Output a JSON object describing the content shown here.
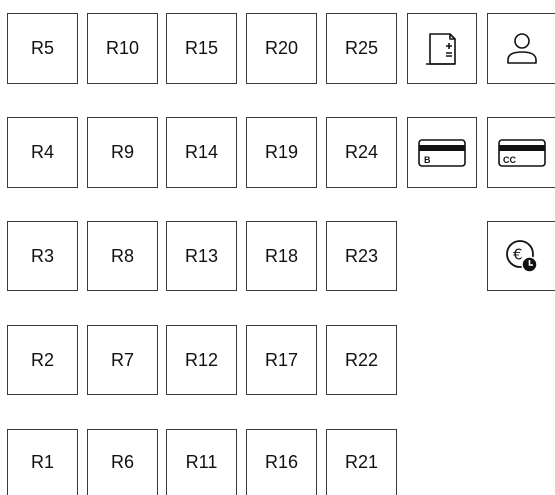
{
  "table_grid": {
    "rows": [
      [
        "R5",
        "R10",
        "R15",
        "R20",
        "R25"
      ],
      [
        "R4",
        "R9",
        "R14",
        "R19",
        "R24"
      ],
      [
        "R3",
        "R8",
        "R13",
        "R18",
        "R23"
      ],
      [
        "R2",
        "R7",
        "R12",
        "R17",
        "R22"
      ],
      [
        "R1",
        "R6",
        "R11",
        "R16",
        "R21"
      ]
    ]
  },
  "action_buttons": {
    "new_bill": {
      "icon": "receipt-add-icon"
    },
    "customer": {
      "icon": "user-icon"
    },
    "bank_card": {
      "icon": "card-b-icon",
      "card_text": "B"
    },
    "credit_card": {
      "icon": "card-cc-icon",
      "card_text": "CC"
    },
    "scheduled_payment": {
      "icon": "euro-clock-icon",
      "currency_symbol": "€"
    }
  }
}
